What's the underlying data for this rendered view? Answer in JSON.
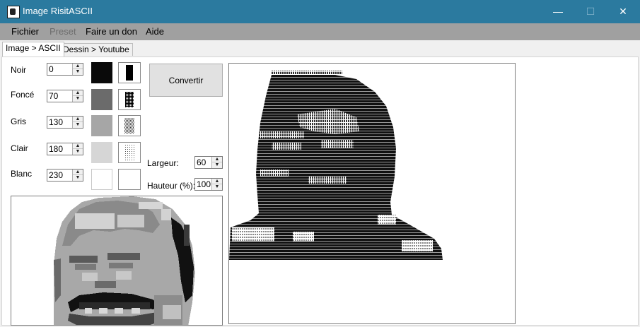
{
  "window": {
    "title": "Image RisitASCII",
    "minimize": "—",
    "maximize": "☐",
    "close": "✕"
  },
  "menu": {
    "file": "Fichier",
    "preset": "Preset",
    "donate": "Faire un don",
    "help": "Aide"
  },
  "tabs": [
    {
      "label": "Image > ASCII"
    },
    {
      "label": "Dessin > Youtube"
    }
  ],
  "levels": [
    {
      "label": "Noir",
      "value": "0",
      "color": "#0a0a0a",
      "pattern_icon": "solid-black-pattern-icon"
    },
    {
      "label": "Foncé",
      "value": "70",
      "color": "#6b6b6b",
      "pattern_icon": "dense-dots-pattern-icon"
    },
    {
      "label": "Gris",
      "value": "130",
      "color": "#a6a6a6",
      "pattern_icon": "medium-dots-pattern-icon"
    },
    {
      "label": "Clair",
      "value": "180",
      "color": "#d6d6d6",
      "pattern_icon": "light-dots-pattern-icon"
    },
    {
      "label": "Blanc",
      "value": "230",
      "color": "#ffffff",
      "pattern_icon": "blank-pattern-icon"
    }
  ],
  "convert_label": "Convertir",
  "width": {
    "label": "Largeur:",
    "value": "60"
  },
  "height": {
    "label": "Hauteur (%):",
    "value": "100"
  },
  "colors": {
    "titlebar": "#2b7a9f",
    "menubar": "#a0a0a0",
    "panel": "#f0f0f0"
  }
}
